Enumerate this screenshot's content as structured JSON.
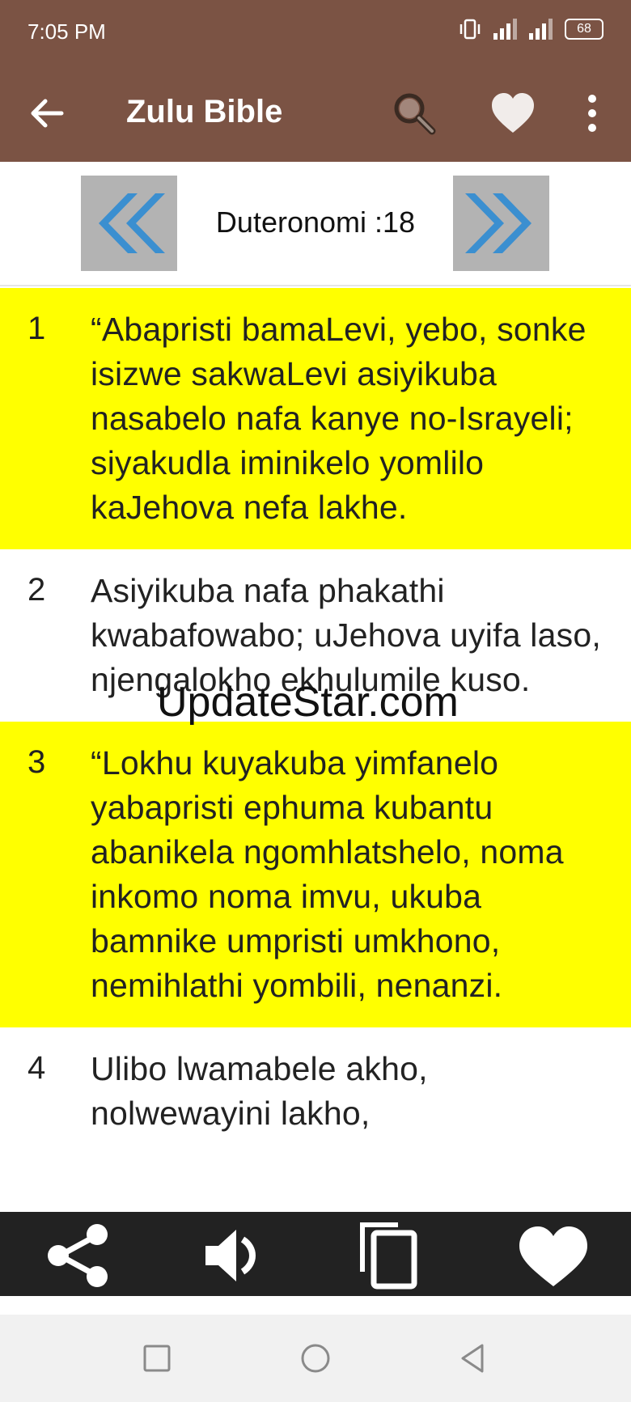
{
  "status_bar": {
    "time": "7:05 PM",
    "battery": "68"
  },
  "app_bar": {
    "title": "Zulu Bible"
  },
  "chapter_nav": {
    "label": "Duteronomi :18"
  },
  "verses": [
    {
      "num": "1",
      "text": "“Abapristi bamaLevi, yebo, sonke isizwe sakwaLevi asiyikuba nasabelo nafa kanye no-Israyeli; siyakudla iminikelo yomlilo kaJehova nefa lakhe.",
      "highlighted": true
    },
    {
      "num": "2",
      "text": "Asiyikuba nafa phakathi kwabafowabo; uJehova uyifa laso, njengalokho ekhulumile kuso.",
      "highlighted": false
    },
    {
      "num": "3",
      "text": "“Lokhu kuyakuba yimfanelo yabapristi ephuma kubantu abanikela ngomhlatshelo, noma inkomo noma imvu, ukuba bamnike umpristi umkhono, nemihlathi yombili, nenanzi.",
      "highlighted": true
    },
    {
      "num": "4",
      "text": "Ulibo lwamabele akho, nolwewayini lakho,",
      "highlighted": false
    }
  ],
  "watermark": "UpdateStar.com",
  "colors": {
    "app_bar": "#7b5344",
    "highlight": "#ffff00",
    "arrow": "#3b8fd0",
    "toolbar": "#222222"
  },
  "icons": {
    "back": "arrow-left-icon",
    "search": "search-icon",
    "favorite": "heart-icon",
    "menu": "more-vert-icon",
    "prev": "double-chevron-left-icon",
    "next": "double-chevron-right-icon",
    "share": "share-icon",
    "speak": "speaker-icon",
    "copy": "copy-icon",
    "bookmark": "heart-icon"
  }
}
